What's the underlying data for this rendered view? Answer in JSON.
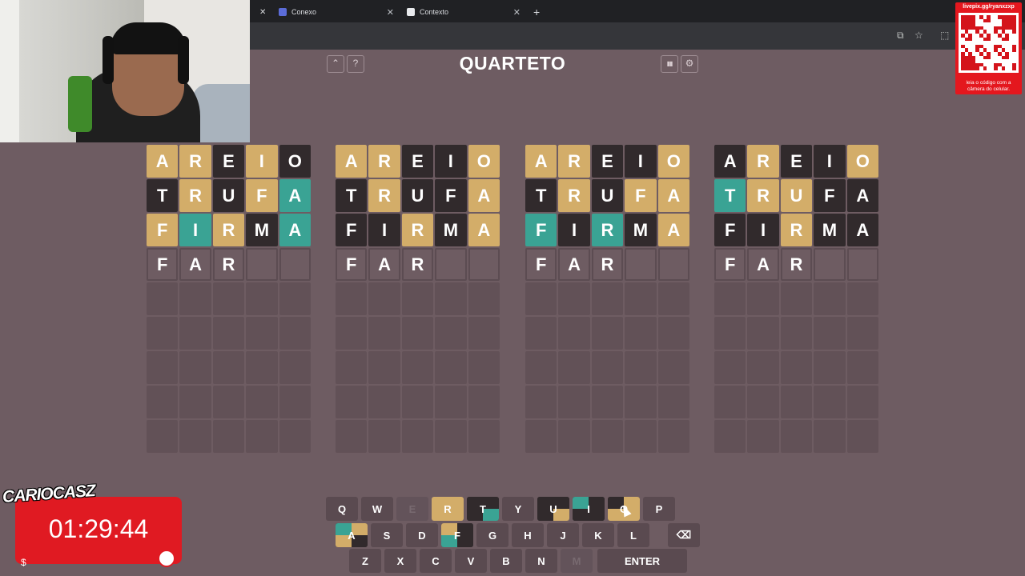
{
  "browser": {
    "tabs": [
      {
        "label": "Conexo",
        "favicon_color": "#5b6cd8"
      },
      {
        "label": "Contexto",
        "favicon_color": "#e8eaed"
      }
    ],
    "close_glyph": "✕",
    "new_tab_glyph": "+",
    "toolbar_icons": [
      "install-icon",
      "star-icon",
      "extensions-icon"
    ]
  },
  "qr_overlay": {
    "url": "livepix.gg/ryanxzxp",
    "caption": "leia o código com a câmera do celular."
  },
  "header": {
    "title": "QUARTETO",
    "left_buttons": [
      {
        "icon": "chevron-up-icon",
        "glyph": "⌃"
      },
      {
        "icon": "help-icon",
        "glyph": "?"
      }
    ],
    "right_buttons": [
      {
        "icon": "stats-icon",
        "glyph": "▮▮"
      },
      {
        "icon": "settings-icon",
        "glyph": "⚙"
      }
    ]
  },
  "colors": {
    "gray": "#312a2c",
    "yellow": "#d3ad69",
    "green": "#3aa394",
    "background": "#6e5c62"
  },
  "boards": [
    {
      "rows": [
        [
          {
            "l": "A",
            "s": "yellow"
          },
          {
            "l": "R",
            "s": "yellow"
          },
          {
            "l": "E",
            "s": "gray"
          },
          {
            "l": "I",
            "s": "yellow"
          },
          {
            "l": "O",
            "s": "gray"
          }
        ],
        [
          {
            "l": "T",
            "s": "gray"
          },
          {
            "l": "R",
            "s": "yellow"
          },
          {
            "l": "U",
            "s": "gray"
          },
          {
            "l": "F",
            "s": "yellow"
          },
          {
            "l": "A",
            "s": "green"
          }
        ],
        [
          {
            "l": "F",
            "s": "yellow"
          },
          {
            "l": "I",
            "s": "green"
          },
          {
            "l": "R",
            "s": "yellow"
          },
          {
            "l": "M",
            "s": "gray"
          },
          {
            "l": "A",
            "s": "green"
          }
        ],
        [
          {
            "l": "F",
            "s": "typed"
          },
          {
            "l": "A",
            "s": "typed"
          },
          {
            "l": "R",
            "s": "typed"
          },
          {
            "l": "",
            "s": "empty"
          },
          {
            "l": "",
            "s": "empty"
          }
        ]
      ]
    },
    {
      "rows": [
        [
          {
            "l": "A",
            "s": "yellow"
          },
          {
            "l": "R",
            "s": "yellow"
          },
          {
            "l": "E",
            "s": "gray"
          },
          {
            "l": "I",
            "s": "gray"
          },
          {
            "l": "O",
            "s": "yellow"
          }
        ],
        [
          {
            "l": "T",
            "s": "gray"
          },
          {
            "l": "R",
            "s": "yellow"
          },
          {
            "l": "U",
            "s": "gray"
          },
          {
            "l": "F",
            "s": "gray"
          },
          {
            "l": "A",
            "s": "yellow"
          }
        ],
        [
          {
            "l": "F",
            "s": "gray"
          },
          {
            "l": "I",
            "s": "gray"
          },
          {
            "l": "R",
            "s": "yellow"
          },
          {
            "l": "M",
            "s": "gray"
          },
          {
            "l": "A",
            "s": "yellow"
          }
        ],
        [
          {
            "l": "F",
            "s": "typed"
          },
          {
            "l": "A",
            "s": "typed"
          },
          {
            "l": "R",
            "s": "typed"
          },
          {
            "l": "",
            "s": "empty"
          },
          {
            "l": "",
            "s": "empty"
          }
        ]
      ]
    },
    {
      "rows": [
        [
          {
            "l": "A",
            "s": "yellow"
          },
          {
            "l": "R",
            "s": "yellow"
          },
          {
            "l": "E",
            "s": "gray"
          },
          {
            "l": "I",
            "s": "gray"
          },
          {
            "l": "O",
            "s": "yellow"
          }
        ],
        [
          {
            "l": "T",
            "s": "gray"
          },
          {
            "l": "R",
            "s": "yellow"
          },
          {
            "l": "U",
            "s": "gray"
          },
          {
            "l": "F",
            "s": "yellow"
          },
          {
            "l": "A",
            "s": "yellow"
          }
        ],
        [
          {
            "l": "F",
            "s": "green"
          },
          {
            "l": "I",
            "s": "gray"
          },
          {
            "l": "R",
            "s": "green"
          },
          {
            "l": "M",
            "s": "gray"
          },
          {
            "l": "A",
            "s": "yellow"
          }
        ],
        [
          {
            "l": "F",
            "s": "typed"
          },
          {
            "l": "A",
            "s": "typed"
          },
          {
            "l": "R",
            "s": "typed"
          },
          {
            "l": "",
            "s": "empty"
          },
          {
            "l": "",
            "s": "empty"
          }
        ]
      ]
    },
    {
      "rows": [
        [
          {
            "l": "A",
            "s": "gray"
          },
          {
            "l": "R",
            "s": "yellow"
          },
          {
            "l": "E",
            "s": "gray"
          },
          {
            "l": "I",
            "s": "gray"
          },
          {
            "l": "O",
            "s": "yellow"
          }
        ],
        [
          {
            "l": "T",
            "s": "green"
          },
          {
            "l": "R",
            "s": "yellow"
          },
          {
            "l": "U",
            "s": "yellow"
          },
          {
            "l": "F",
            "s": "gray"
          },
          {
            "l": "A",
            "s": "gray"
          }
        ],
        [
          {
            "l": "F",
            "s": "gray"
          },
          {
            "l": "I",
            "s": "gray"
          },
          {
            "l": "R",
            "s": "yellow"
          },
          {
            "l": "M",
            "s": "gray"
          },
          {
            "l": "A",
            "s": "gray"
          }
        ],
        [
          {
            "l": "F",
            "s": "typed"
          },
          {
            "l": "A",
            "s": "typed"
          },
          {
            "l": "R",
            "s": "typed"
          },
          {
            "l": "",
            "s": "empty"
          },
          {
            "l": "",
            "s": "empty"
          }
        ]
      ]
    }
  ],
  "keyboard": {
    "rows": [
      [
        {
          "l": "Q",
          "s": "default"
        },
        {
          "l": "W",
          "s": "default"
        },
        {
          "l": "E",
          "s": "disabled"
        },
        {
          "l": "R",
          "s": "yellow"
        },
        {
          "l": "T",
          "s": "split",
          "q": [
            "gray",
            "gray",
            "gray",
            "green"
          ]
        },
        {
          "l": "Y",
          "s": "default"
        },
        {
          "l": "U",
          "s": "split",
          "q": [
            "gray",
            "gray",
            "gray",
            "yellow"
          ]
        },
        {
          "l": "I",
          "s": "split",
          "q": [
            "green",
            "gray",
            "gray",
            "gray"
          ]
        },
        {
          "l": "O",
          "s": "split",
          "q": [
            "gray",
            "yellow",
            "yellow",
            "yellow"
          ]
        },
        {
          "l": "P",
          "s": "default"
        }
      ],
      [
        {
          "l": "A",
          "s": "split",
          "q": [
            "green",
            "yellow",
            "yellow",
            "gray"
          ]
        },
        {
          "l": "S",
          "s": "default"
        },
        {
          "l": "D",
          "s": "default"
        },
        {
          "l": "F",
          "s": "split",
          "q": [
            "yellow",
            "gray",
            "green",
            "gray"
          ]
        },
        {
          "l": "G",
          "s": "default"
        },
        {
          "l": "H",
          "s": "default"
        },
        {
          "l": "J",
          "s": "default"
        },
        {
          "l": "K",
          "s": "default"
        },
        {
          "l": "L",
          "s": "default"
        },
        {
          "l": "⌫",
          "s": "default",
          "name": "backspace-key"
        }
      ],
      [
        {
          "l": "Z",
          "s": "default"
        },
        {
          "l": "X",
          "s": "default"
        },
        {
          "l": "C",
          "s": "default"
        },
        {
          "l": "V",
          "s": "default"
        },
        {
          "l": "B",
          "s": "default"
        },
        {
          "l": "N",
          "s": "default"
        },
        {
          "l": "M",
          "s": "disabled"
        },
        {
          "l": "ENTER",
          "s": "default",
          "name": "enter-key"
        }
      ]
    ]
  },
  "streamer": {
    "logo_text": "CARIOCASZ",
    "timer": "01:29:44",
    "dollar_glyph": "$"
  }
}
